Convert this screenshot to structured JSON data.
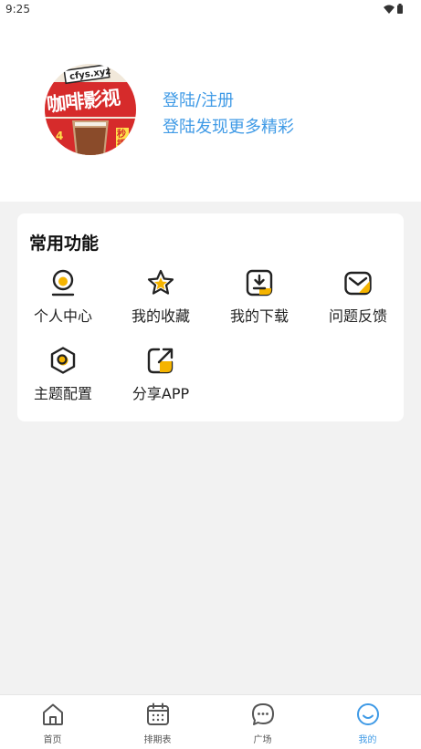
{
  "status_bar": {
    "time": "9:25"
  },
  "profile": {
    "avatar_text": "咖啡影视",
    "avatar_domain": "cfys.xyz",
    "avatar_tag_left": "4",
    "avatar_tag_right": "秒播",
    "login_title": "登陆/注册",
    "login_subtitle": "登陆发现更多精彩"
  },
  "functions": {
    "title": "常用功能",
    "items": [
      {
        "label": "个人中心",
        "icon": "user-circle-icon"
      },
      {
        "label": "我的收藏",
        "icon": "star-icon"
      },
      {
        "label": "我的下载",
        "icon": "download-icon"
      },
      {
        "label": "问题反馈",
        "icon": "mail-icon"
      },
      {
        "label": "主题配置",
        "icon": "hexagon-settings-icon"
      },
      {
        "label": "分享APP",
        "icon": "share-icon"
      }
    ]
  },
  "tab_bar": {
    "items": [
      {
        "label": "首页",
        "icon": "home-icon",
        "active": false
      },
      {
        "label": "排期表",
        "icon": "calendar-icon",
        "active": false
      },
      {
        "label": "广场",
        "icon": "chat-bubble-icon",
        "active": false
      },
      {
        "label": "我的",
        "icon": "smile-icon",
        "active": true
      }
    ]
  },
  "colors": {
    "accent": "#3f9ae6",
    "icon_stroke": "#222222",
    "icon_fill": "#f5b400",
    "avatar_red": "#d62b2b"
  }
}
